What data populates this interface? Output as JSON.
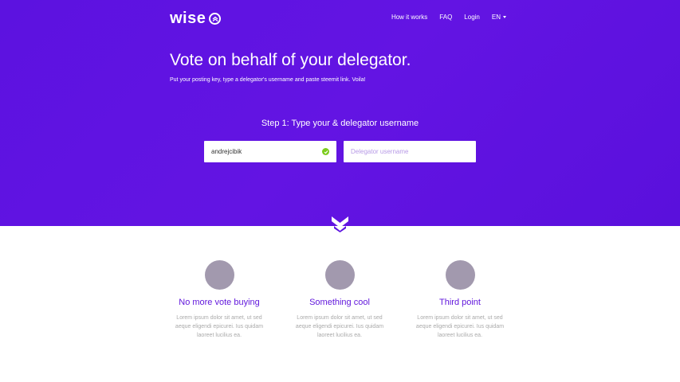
{
  "brand": {
    "name": "wise",
    "accent": "#5c12e0",
    "check_color": "#7ccc1d"
  },
  "nav": {
    "items": [
      {
        "label": "How it works"
      },
      {
        "label": "FAQ"
      },
      {
        "label": "Login"
      }
    ],
    "language": "EN"
  },
  "hero": {
    "title": "Vote on behalf of your delegator.",
    "subtitle": "Put your posting key, type a delegator's username and paste steemit link. Voila!",
    "step_label": "Step 1: Type your & delegator username"
  },
  "form": {
    "username_value": "andrejcibik",
    "delegator_placeholder": "Delegator username"
  },
  "features": [
    {
      "title": "No more vote buying",
      "text": "Lorem ipsum dolor sit amet, ut sed aeque eligendi epicurei. Ius quidam laoreet lucilius ea."
    },
    {
      "title": "Something cool",
      "text": "Lorem ipsum dolor sit amet, ut sed aeque eligendi epicurei. Ius quidam laoreet lucilius ea."
    },
    {
      "title": "Third point",
      "text": "Lorem ipsum dolor sit amet, ut sed aeque eligendi epicurei. Ius quidam laoreet lucilius ea."
    }
  ]
}
